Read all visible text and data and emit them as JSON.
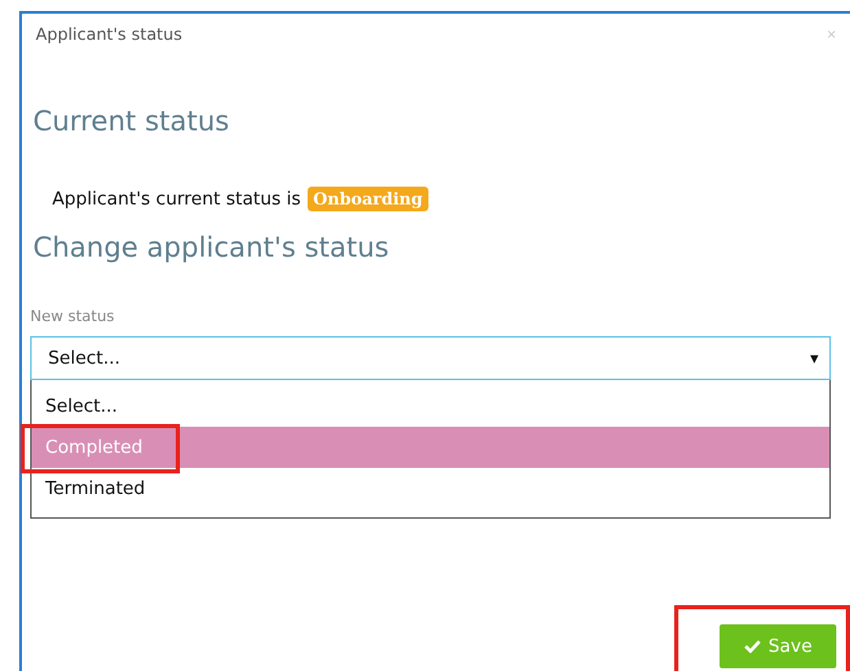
{
  "dialog": {
    "title": "Applicant's status",
    "close": "×"
  },
  "current": {
    "heading": "Current status",
    "sentence": "Applicant's current status is",
    "badge": "Onboarding"
  },
  "change": {
    "heading": "Change applicant's status",
    "label": "New status",
    "select": {
      "value": "Select...",
      "caret": "▾",
      "options": [
        {
          "label": "Select...",
          "hovered": false,
          "highlighted": false
        },
        {
          "label": "Completed",
          "hovered": true,
          "highlighted": true
        },
        {
          "label": "Terminated",
          "hovered": false,
          "highlighted": false
        }
      ]
    }
  },
  "save": {
    "label": "Save",
    "highlighted": true
  }
}
